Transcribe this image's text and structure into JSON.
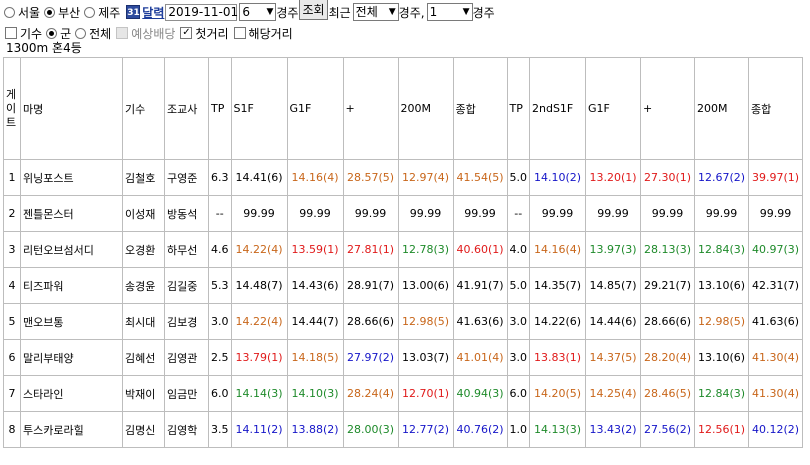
{
  "filters": {
    "track_options": [
      "서울",
      "부산",
      "제주"
    ],
    "track_selected": "부산",
    "calendar_label": "달력",
    "date_value": "2019-11-01",
    "race_no_value": "6",
    "race_suffix": "경주",
    "search_button": "조회",
    "recent_label": "최근",
    "recent_value": "전체",
    "recent_suffix": "경주,",
    "count_value": "1",
    "count_suffix": "경주"
  },
  "options": {
    "jockey_label": "기수",
    "group_label": "군",
    "all_label": "전체",
    "expected_dividend_label": "예상배당",
    "first_distance_label": "첫거리",
    "matching_distance_label": "해당거리"
  },
  "race_info": "1300m  혼4등",
  "colors": {
    "blue": "#1515c8",
    "red": "#e01a1a",
    "green": "#1e8a2a",
    "orange": "#c8661a",
    "black": "#000000"
  },
  "table": {
    "headers": [
      "게이트",
      "마명",
      "기수",
      "조교사",
      "TP",
      "S1F",
      "G1F",
      "+",
      "200M",
      "종합",
      "TP",
      "2ndS1F",
      "G1F",
      "+",
      "200M",
      "종합"
    ],
    "rows": [
      {
        "gate": "1",
        "horse": "위닝포스트",
        "jockey": "김철호",
        "trainer": "구영준",
        "tp1": "6.3",
        "c": [
          [
            "14.41(6)",
            "black",
            false
          ],
          [
            "14.16(4)",
            "orange",
            true
          ],
          [
            "28.57(5)",
            "orange",
            true
          ],
          [
            "12.97(4)",
            "orange",
            true
          ],
          [
            "41.54(5)",
            "orange",
            true
          ]
        ],
        "tp2": "5.0",
        "d": [
          [
            "14.10(2)",
            "blue",
            true
          ],
          [
            "13.20(1)",
            "red",
            true
          ],
          [
            "27.30(1)",
            "red",
            true
          ],
          [
            "12.67(2)",
            "blue",
            true
          ],
          [
            "39.97(1)",
            "red",
            true
          ]
        ]
      },
      {
        "gate": "2",
        "horse": "젠틀몬스터",
        "jockey": "이성재",
        "trainer": "방동석",
        "tp1": "--",
        "c": [
          [
            "99.99",
            "black",
            false
          ],
          [
            "99.99",
            "black",
            false
          ],
          [
            "99.99",
            "black",
            false
          ],
          [
            "99.99",
            "black",
            false
          ],
          [
            "99.99",
            "black",
            false
          ]
        ],
        "tp2": "--",
        "d": [
          [
            "99.99",
            "black",
            false
          ],
          [
            "99.99",
            "black",
            false
          ],
          [
            "99.99",
            "black",
            false
          ],
          [
            "99.99",
            "black",
            false
          ],
          [
            "99.99",
            "black",
            false
          ]
        ]
      },
      {
        "gate": "3",
        "horse": "리턴오브섬서디",
        "jockey": "오경환",
        "trainer": "하무선",
        "tp1": "4.6",
        "c": [
          [
            "14.22(4)",
            "orange",
            true
          ],
          [
            "13.59(1)",
            "red",
            true
          ],
          [
            "27.81(1)",
            "red",
            true
          ],
          [
            "12.78(3)",
            "green",
            true
          ],
          [
            "40.60(1)",
            "red",
            true
          ]
        ],
        "tp2": "4.0",
        "d": [
          [
            "14.16(4)",
            "orange",
            true
          ],
          [
            "13.97(3)",
            "green",
            true
          ],
          [
            "28.13(3)",
            "green",
            true
          ],
          [
            "12.84(3)",
            "green",
            true
          ],
          [
            "40.97(3)",
            "green",
            true
          ]
        ]
      },
      {
        "gate": "4",
        "horse": "티즈파워",
        "jockey": "송경윤",
        "trainer": "김길중",
        "tp1": "5.3",
        "c": [
          [
            "14.48(7)",
            "black",
            false
          ],
          [
            "14.43(6)",
            "black",
            false
          ],
          [
            "28.91(7)",
            "black",
            false
          ],
          [
            "13.00(6)",
            "black",
            false
          ],
          [
            "41.91(7)",
            "black",
            false
          ]
        ],
        "tp2": "5.0",
        "d": [
          [
            "14.35(7)",
            "black",
            false
          ],
          [
            "14.85(7)",
            "black",
            false
          ],
          [
            "29.21(7)",
            "black",
            false
          ],
          [
            "13.10(6)",
            "black",
            false
          ],
          [
            "42.31(7)",
            "black",
            false
          ]
        ]
      },
      {
        "gate": "5",
        "horse": "맨오브통",
        "jockey": "최시대",
        "trainer": "김보경",
        "tp1": "3.0",
        "c": [
          [
            "14.22(4)",
            "orange",
            true
          ],
          [
            "14.44(7)",
            "black",
            false
          ],
          [
            "28.66(6)",
            "black",
            false
          ],
          [
            "12.98(5)",
            "orange",
            true
          ],
          [
            "41.63(6)",
            "black",
            false
          ]
        ],
        "tp2": "3.0",
        "d": [
          [
            "14.22(6)",
            "black",
            false
          ],
          [
            "14.44(6)",
            "black",
            false
          ],
          [
            "28.66(6)",
            "black",
            false
          ],
          [
            "12.98(5)",
            "orange",
            true
          ],
          [
            "41.63(6)",
            "black",
            false
          ]
        ]
      },
      {
        "gate": "6",
        "horse": "말리부태양",
        "jockey": "김혜선",
        "trainer": "김영관",
        "tp1": "2.5",
        "c": [
          [
            "13.79(1)",
            "red",
            true
          ],
          [
            "14.18(5)",
            "orange",
            true
          ],
          [
            "27.97(2)",
            "blue",
            true
          ],
          [
            "13.03(7)",
            "black",
            false
          ],
          [
            "41.01(4)",
            "orange",
            true
          ]
        ],
        "tp2": "3.0",
        "d": [
          [
            "13.83(1)",
            "red",
            true
          ],
          [
            "14.37(5)",
            "orange",
            true
          ],
          [
            "28.20(4)",
            "orange",
            true
          ],
          [
            "13.10(6)",
            "black",
            false
          ],
          [
            "41.30(4)",
            "orange",
            true
          ]
        ]
      },
      {
        "gate": "7",
        "horse": "스타라인",
        "jockey": "박재이",
        "trainer": "임금만",
        "tp1": "6.0",
        "c": [
          [
            "14.14(3)",
            "green",
            true
          ],
          [
            "14.10(3)",
            "green",
            true
          ],
          [
            "28.24(4)",
            "orange",
            true
          ],
          [
            "12.70(1)",
            "red",
            true
          ],
          [
            "40.94(3)",
            "green",
            true
          ]
        ],
        "tp2": "6.0",
        "d": [
          [
            "14.20(5)",
            "orange",
            true
          ],
          [
            "14.25(4)",
            "orange",
            true
          ],
          [
            "28.46(5)",
            "orange",
            true
          ],
          [
            "12.84(3)",
            "green",
            true
          ],
          [
            "41.30(4)",
            "orange",
            true
          ]
        ]
      },
      {
        "gate": "8",
        "horse": "투스카로라힐",
        "jockey": "김명신",
        "trainer": "김영학",
        "tp1": "3.5",
        "c": [
          [
            "14.11(2)",
            "blue",
            true
          ],
          [
            "13.88(2)",
            "blue",
            true
          ],
          [
            "28.00(3)",
            "green",
            true
          ],
          [
            "12.77(2)",
            "blue",
            true
          ],
          [
            "40.76(2)",
            "blue",
            true
          ]
        ],
        "tp2": "1.0",
        "d": [
          [
            "14.13(3)",
            "green",
            true
          ],
          [
            "13.43(2)",
            "blue",
            true
          ],
          [
            "27.56(2)",
            "blue",
            true
          ],
          [
            "12.56(1)",
            "red",
            true
          ],
          [
            "40.12(2)",
            "blue",
            true
          ]
        ]
      }
    ]
  }
}
